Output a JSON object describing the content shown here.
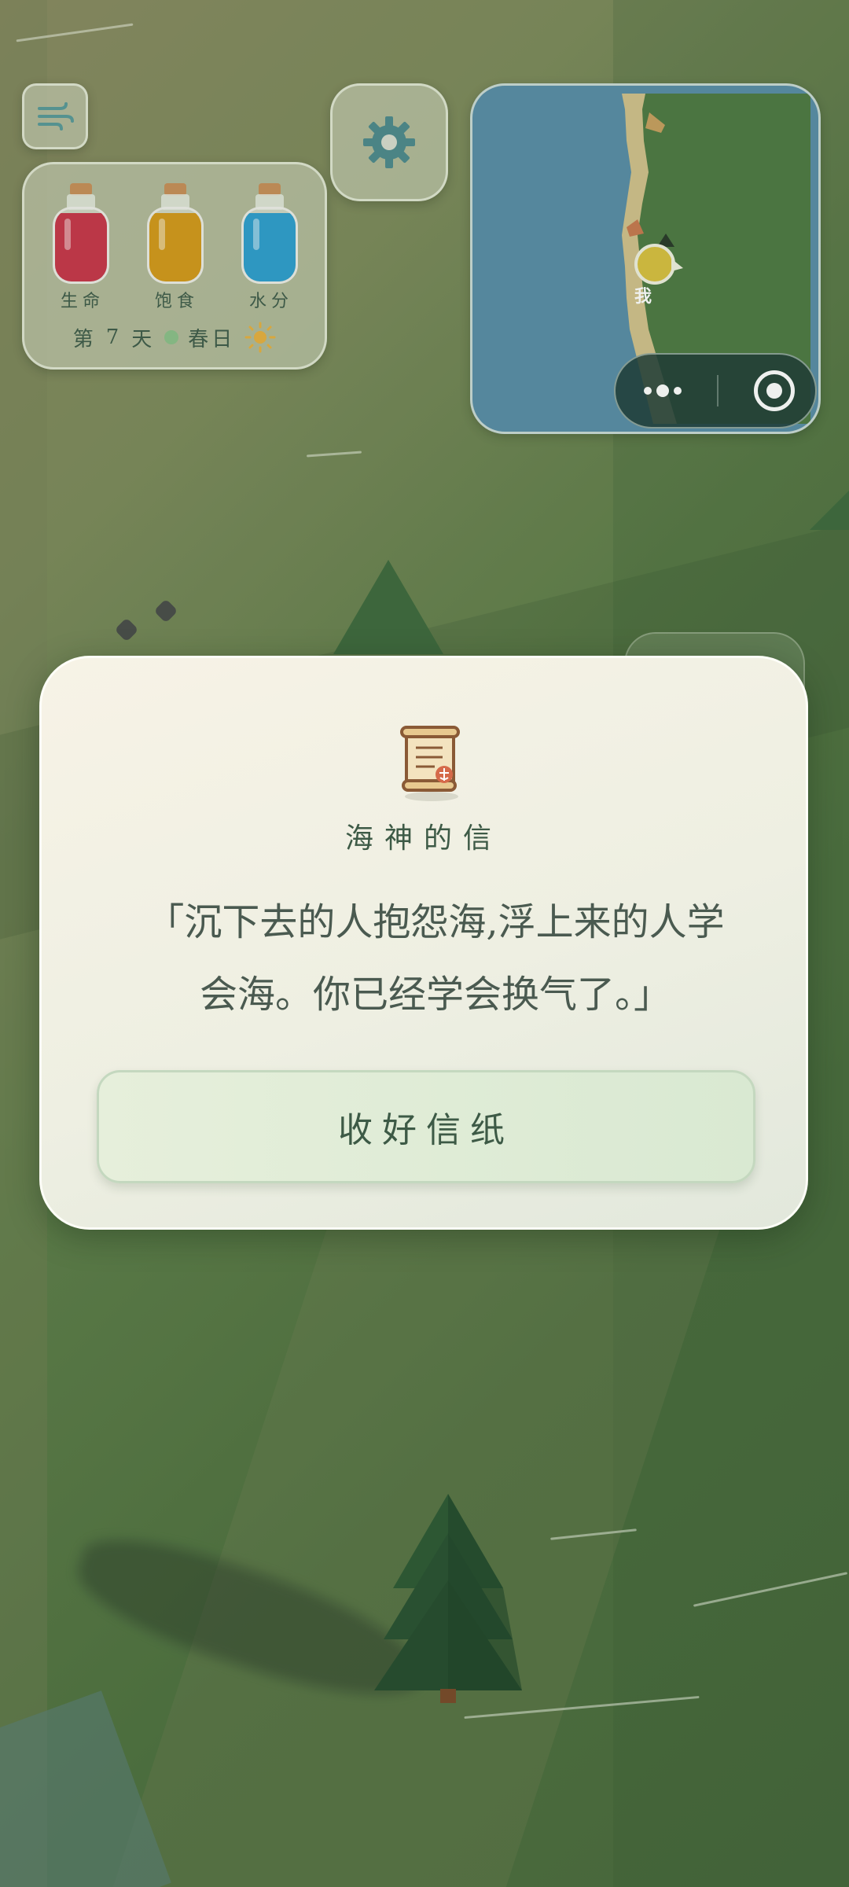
{
  "hud": {
    "wind_icon": "wind-icon",
    "settings_icon": "gear-icon",
    "stats": [
      {
        "label": "生命",
        "color": "#c8374a",
        "level": 0.95
      },
      {
        "label": "饱食",
        "color": "#d4991c",
        "level": 0.95
      },
      {
        "label": "水分",
        "color": "#2f9fcf",
        "level": 0.95
      }
    ],
    "day_prefix": "第",
    "day_number": "7",
    "day_suffix": "天",
    "season": "春日",
    "season_color": "#8cc08a",
    "weather_icon": "sun-icon"
  },
  "minimap": {
    "player_label": "我",
    "more_icon": "more-dots-icon",
    "target_icon": "target-icon",
    "colors": {
      "water": "#5a8ea8",
      "sand": "#d2c28c",
      "grass": "#4f7a44"
    }
  },
  "dialog": {
    "icon": "scroll-letter-icon",
    "title": "海神的信",
    "message": "「沉下去的人抱怨海,浮上来的人学会海。你已经学会换气了。」",
    "button_label": "收好信纸"
  },
  "colors": {
    "accent_text": "#3d5a46",
    "dialog_bg": "#f4f1e4",
    "button_bg": "#dcebd4"
  }
}
